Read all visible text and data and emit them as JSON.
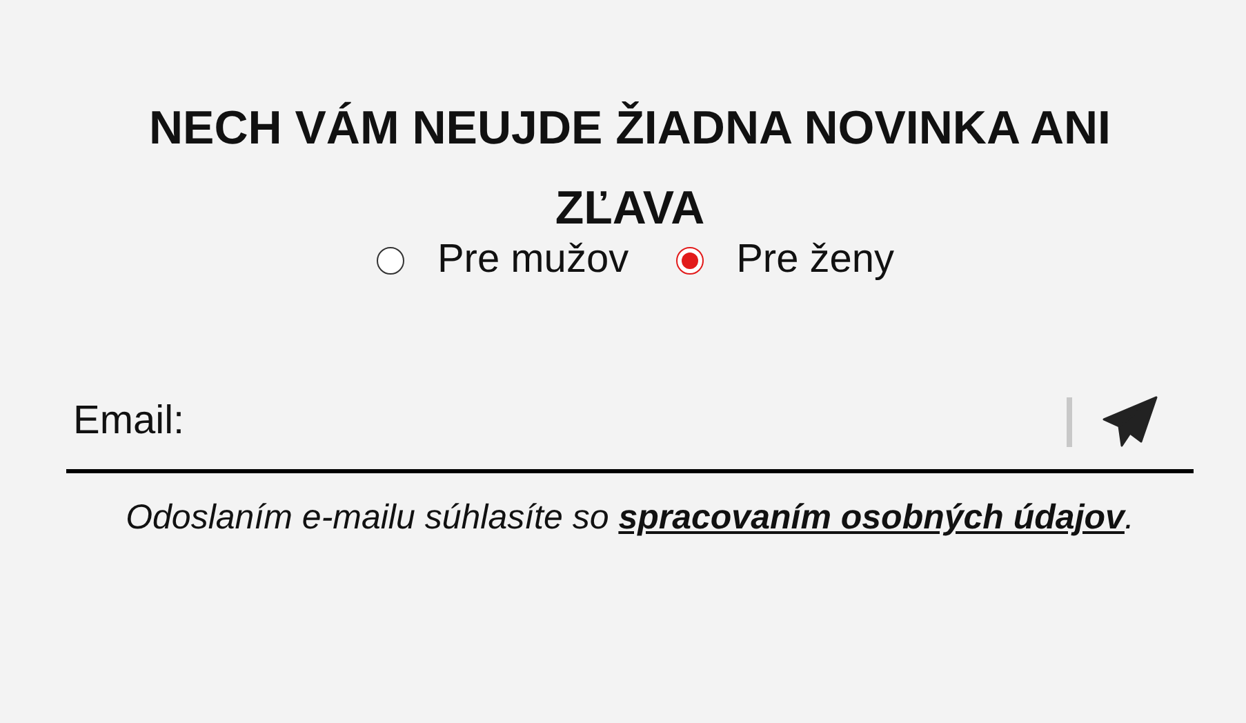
{
  "title": "NECH VÁM NEUJDE ŽIADNA NOVINKA ANI ZĽAVA",
  "audience_options": [
    {
      "label": "Pre mužov",
      "selected": false
    },
    {
      "label": "Pre ženy",
      "selected": true
    }
  ],
  "email": {
    "label": "Email:"
  },
  "consent": {
    "text": "Odoslaním e-mailu súhlasíte so ",
    "link": "spracovaním osobných údajov",
    "after": "."
  }
}
